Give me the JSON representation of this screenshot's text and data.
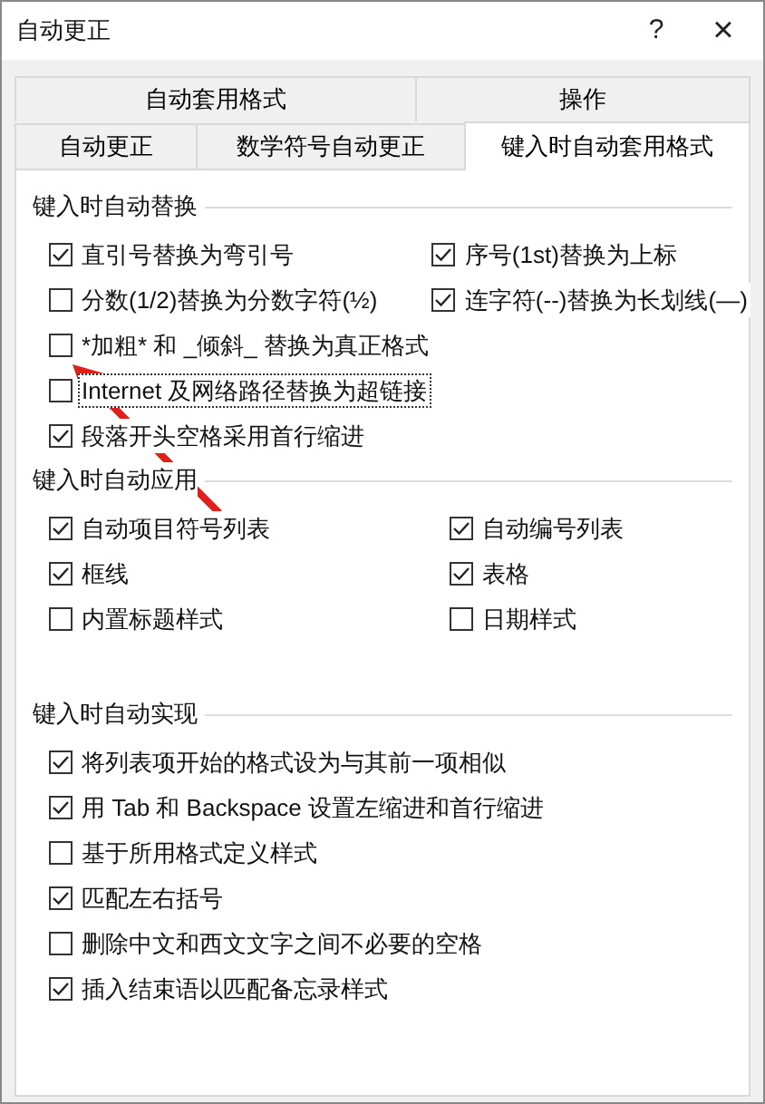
{
  "window": {
    "title": "自动更正",
    "help": "?",
    "close": "×"
  },
  "tab_rows": [
    [
      {
        "label": "自动套用格式",
        "selected": false
      },
      {
        "label": "操作",
        "selected": false
      }
    ],
    [
      {
        "label": "自动更正",
        "selected": false
      },
      {
        "label": "数学符号自动更正",
        "selected": false
      },
      {
        "label": "键入时自动套用格式",
        "selected": true
      }
    ]
  ],
  "sections": [
    {
      "heading": "键入时自动替换",
      "columns": [
        [
          {
            "label": "直引号替换为弯引号",
            "checked": true,
            "focused": false
          },
          {
            "label": "分数(1/2)替换为分数字符(½)",
            "checked": false,
            "focused": false
          },
          {
            "label": "*加粗* 和 _倾斜_ 替换为真正格式",
            "checked": false,
            "focused": false
          },
          {
            "label": "Internet 及网络路径替换为超链接",
            "checked": false,
            "focused": true
          },
          {
            "label": "段落开头空格采用首行缩进",
            "checked": true,
            "focused": false
          }
        ],
        [
          {
            "label": "序号(1st)替换为上标",
            "checked": true,
            "focused": false
          },
          {
            "label": "连字符(--)替换为长划线(—)",
            "checked": true,
            "focused": false
          }
        ]
      ]
    },
    {
      "heading": "键入时自动应用",
      "columns": [
        [
          {
            "label": "自动项目符号列表",
            "checked": true,
            "focused": false
          },
          {
            "label": "框线",
            "checked": true,
            "focused": false
          },
          {
            "label": "内置标题样式",
            "checked": false,
            "focused": false
          }
        ],
        [
          {
            "label": "自动编号列表",
            "checked": true,
            "focused": false
          },
          {
            "label": "表格",
            "checked": true,
            "focused": false
          },
          {
            "label": "日期样式",
            "checked": false,
            "focused": false
          }
        ]
      ]
    },
    {
      "heading": "键入时自动实现",
      "columns": [
        [
          {
            "label": "将列表项开始的格式设为与其前一项相似",
            "checked": true,
            "focused": false
          },
          {
            "label": "用 Tab 和 Backspace 设置左缩进和首行缩进",
            "checked": true,
            "focused": false
          },
          {
            "label": "基于所用格式定义样式",
            "checked": false,
            "focused": false
          },
          {
            "label": "匹配左右括号",
            "checked": true,
            "focused": false
          },
          {
            "label": "删除中文和西文文字之间不必要的空格",
            "checked": false,
            "focused": false
          },
          {
            "label": "插入结束语以匹配备忘录样式",
            "checked": true,
            "focused": false
          }
        ]
      ]
    }
  ]
}
